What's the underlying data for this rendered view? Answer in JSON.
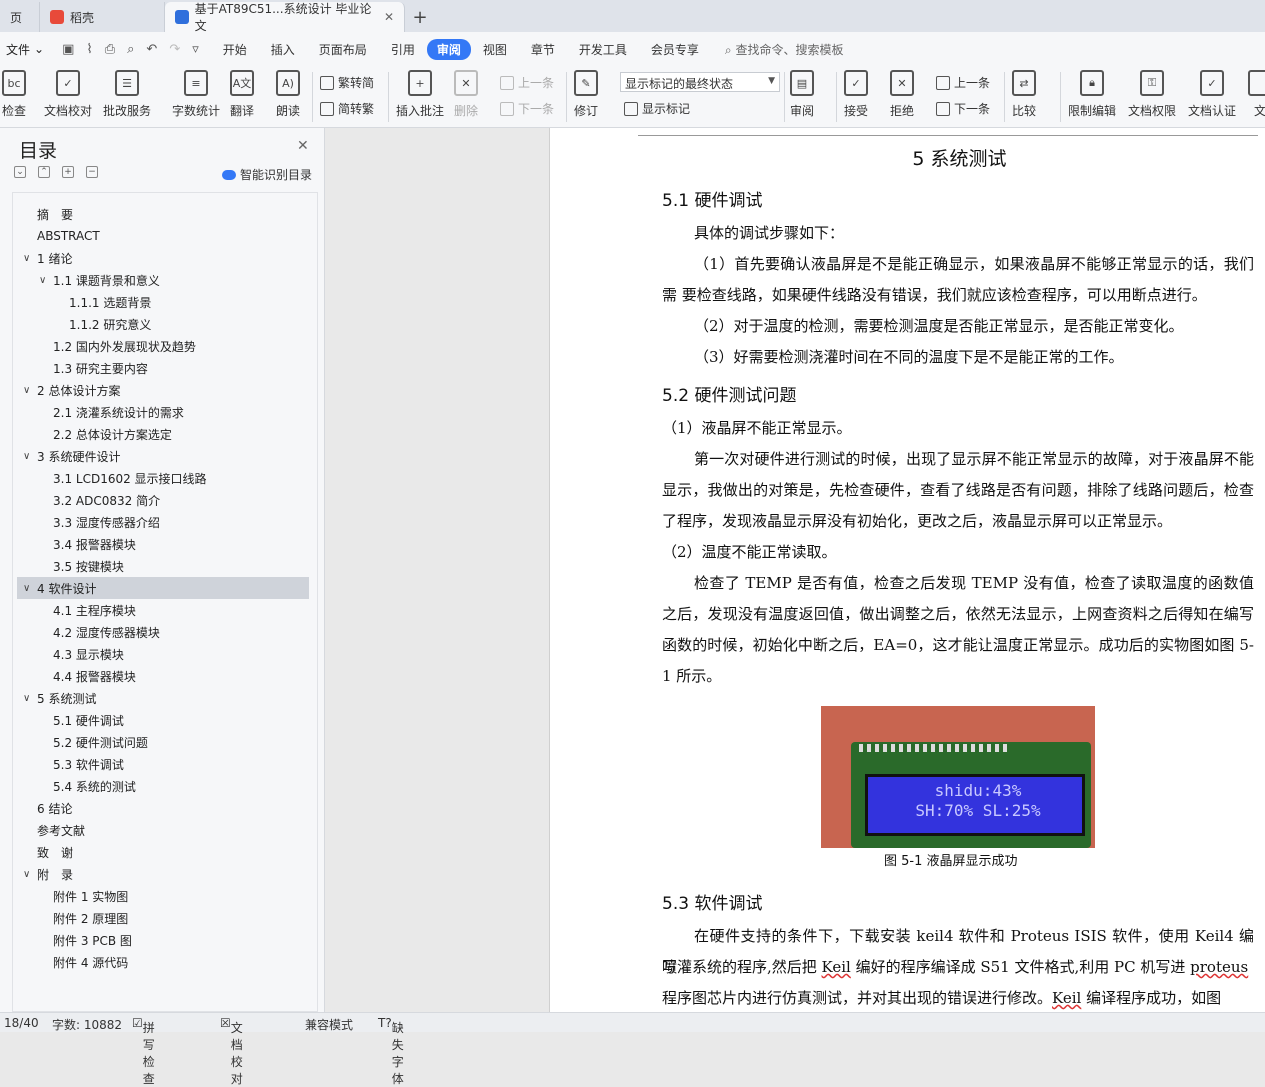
{
  "tabs": [
    {
      "label": "页"
    },
    {
      "label": "稻壳"
    },
    {
      "label": "基于AT89C51...系统设计 毕业论文"
    }
  ],
  "menu": {
    "file": "文件",
    "items": [
      "开始",
      "插入",
      "页面布局",
      "引用",
      "审阅",
      "视图",
      "章节",
      "开发工具",
      "会员专享"
    ],
    "selected": "审阅",
    "search": "查找命令、搜索模板"
  },
  "ribbon": {
    "check": "检查",
    "doc_proof": "文档校对",
    "batch_service": "批改服务",
    "word_count": "字数统计",
    "translate": "翻译",
    "read_aloud": "朗读",
    "trad_to_simp": "繁转简",
    "simp_to_trad": "简转繁",
    "insert_comment": "插入批注",
    "delete": "删除",
    "prev": "上一条",
    "next": "下一条",
    "track": "修订",
    "markup_select": "显示标记的最终状态",
    "show_markup": "显示标记",
    "review": "审阅",
    "accept": "接受",
    "reject": "拒绝",
    "prev2": "上一条",
    "next2": "下一条",
    "compare": "比较",
    "restrict_edit": "限制编辑",
    "doc_rights": "文档权限",
    "doc_cert": "文档认证",
    "doc_more": "文"
  },
  "sidebar": {
    "title": "目录",
    "smart": "智能识别目录",
    "items": [
      {
        "label": "摘　要",
        "level": 0,
        "caret": ""
      },
      {
        "label": "ABSTRACT",
        "level": 0,
        "caret": ""
      },
      {
        "label": "1  绪论",
        "level": 0,
        "caret": "v"
      },
      {
        "label": "1.1  课题背景和意义",
        "level": 1,
        "caret": "v"
      },
      {
        "label": "1.1.1 选题背景",
        "level": 2,
        "caret": ""
      },
      {
        "label": "1.1.2 研究意义",
        "level": 2,
        "caret": ""
      },
      {
        "label": "1.2  国内外发展现状及趋势",
        "level": 1,
        "caret": ""
      },
      {
        "label": "1.3 研究主要内容",
        "level": 1,
        "caret": ""
      },
      {
        "label": "2  总体设计方案",
        "level": 0,
        "caret": "v"
      },
      {
        "label": "2.1  浇灌系统设计的需求",
        "level": 1,
        "caret": ""
      },
      {
        "label": "2.2  总体设计方案选定",
        "level": 1,
        "caret": ""
      },
      {
        "label": "3  系统硬件设计",
        "level": 0,
        "caret": "v"
      },
      {
        "label": "3.1 LCD1602 显示接口线路",
        "level": 1,
        "caret": ""
      },
      {
        "label": "3.2 ADC0832 简介",
        "level": 1,
        "caret": ""
      },
      {
        "label": "3.3  湿度传感器介绍",
        "level": 1,
        "caret": ""
      },
      {
        "label": "3.4  报警器模块",
        "level": 1,
        "caret": ""
      },
      {
        "label": "3.5  按键模块",
        "level": 1,
        "caret": ""
      },
      {
        "label": "4  软件设计",
        "level": 0,
        "caret": "v",
        "selected": true
      },
      {
        "label": "4.1  主程序模块",
        "level": 1,
        "caret": ""
      },
      {
        "label": "4.2  湿度传感器模块",
        "level": 1,
        "caret": ""
      },
      {
        "label": "4.3  显示模块",
        "level": 1,
        "caret": ""
      },
      {
        "label": "4.4  报警器模块",
        "level": 1,
        "caret": ""
      },
      {
        "label": "5  系统测试",
        "level": 0,
        "caret": "v"
      },
      {
        "label": "5.1  硬件调试",
        "level": 1,
        "caret": ""
      },
      {
        "label": "5.2  硬件测试问题",
        "level": 1,
        "caret": ""
      },
      {
        "label": "5.3  软件调试",
        "level": 1,
        "caret": ""
      },
      {
        "label": "5.4  系统的测试",
        "level": 1,
        "caret": ""
      },
      {
        "label": "6  结论",
        "level": 0,
        "caret": ""
      },
      {
        "label": "参考文献",
        "level": 0,
        "caret": ""
      },
      {
        "label": "致　谢",
        "level": 0,
        "caret": ""
      },
      {
        "label": "附　录",
        "level": 0,
        "caret": "v"
      },
      {
        "label": "附件 1  实物图",
        "level": 1,
        "caret": ""
      },
      {
        "label": "附件 2  原理图",
        "level": 1,
        "caret": ""
      },
      {
        "label": "附件 3 PCB 图",
        "level": 1,
        "caret": ""
      },
      {
        "label": "附件 4  源代码",
        "level": 1,
        "caret": ""
      }
    ]
  },
  "document": {
    "chapter": "5  系统测试",
    "s51": "5.1  硬件调试",
    "p1": "具体的调试步骤如下：",
    "p2": "（1）首先要确认液晶屏是不是能正确显示，如果液晶屏不能够正常显示的话，我们需  要检查线路，如果硬件线路没有错误，我们就应该检查程序，可以用断点进行。",
    "p3": "（2）对于温度的检测，需要检测温度是否能正常显示，是否能正常变化。",
    "p4": "（3）好需要检测浇灌时间在不同的温度下是不是能正常的工作。",
    "s52": "5.2  硬件测试问题",
    "p5": "（1）液晶屏不能正常显示。",
    "p6": "第一次对硬件进行测试的时候，出现了显示屏不能正常显示的故障，对于液晶屏不能显示，我做出的对策是，先检查硬件，查看了线路是否有问题，排除了线路问题后，检查了程序，发现液晶显示屏没有初始化，更改之后，液晶显示屏可以正常显示。",
    "p7": "（2）温度不能正常读取。",
    "p8": "检查了 TEMP 是否有值，检查之后发现 TEMP 没有值，检查了读取温度的函数值之后，发现没有温度返回值，做出调整之后，依然无法显示，上网查资料之后得知在编写函数的时候，初始化中断之后，EA=0，这才能让温度正常显示。成功后的实物图如图 5-1 所示。",
    "lcd_line1": "shidu:43%",
    "lcd_line2": "SH:70%  SL:25%",
    "fig_caption": "图 5-1    液晶屏显示成功",
    "s53": "5.3  软件调试",
    "p9a": "在硬件支持的条件下，下载安装 keil4 软件和 Proteus ISIS 软件，使用 Keil4 编写",
    "p9b_pre": "喷灌系统的程序,然后把 ",
    "p9b_keil": "Keil",
    "p9b_mid": " 编好的程序编译成 S51 文件格式,利用 PC 机写进 ",
    "p9b_proteus": "proteus",
    "p9c_pre": "程序图芯片内进行仿真测试，并对其出现的错误进行修改。",
    "p9c_keil": "Keil",
    "p9c_post": " 编译程序成功，如图"
  },
  "status": {
    "page": "18/40",
    "words": "字数: 10882",
    "spell": "拼写检查",
    "proof": "文档校对",
    "compat": "兼容模式",
    "missing_font": "缺失字体"
  }
}
